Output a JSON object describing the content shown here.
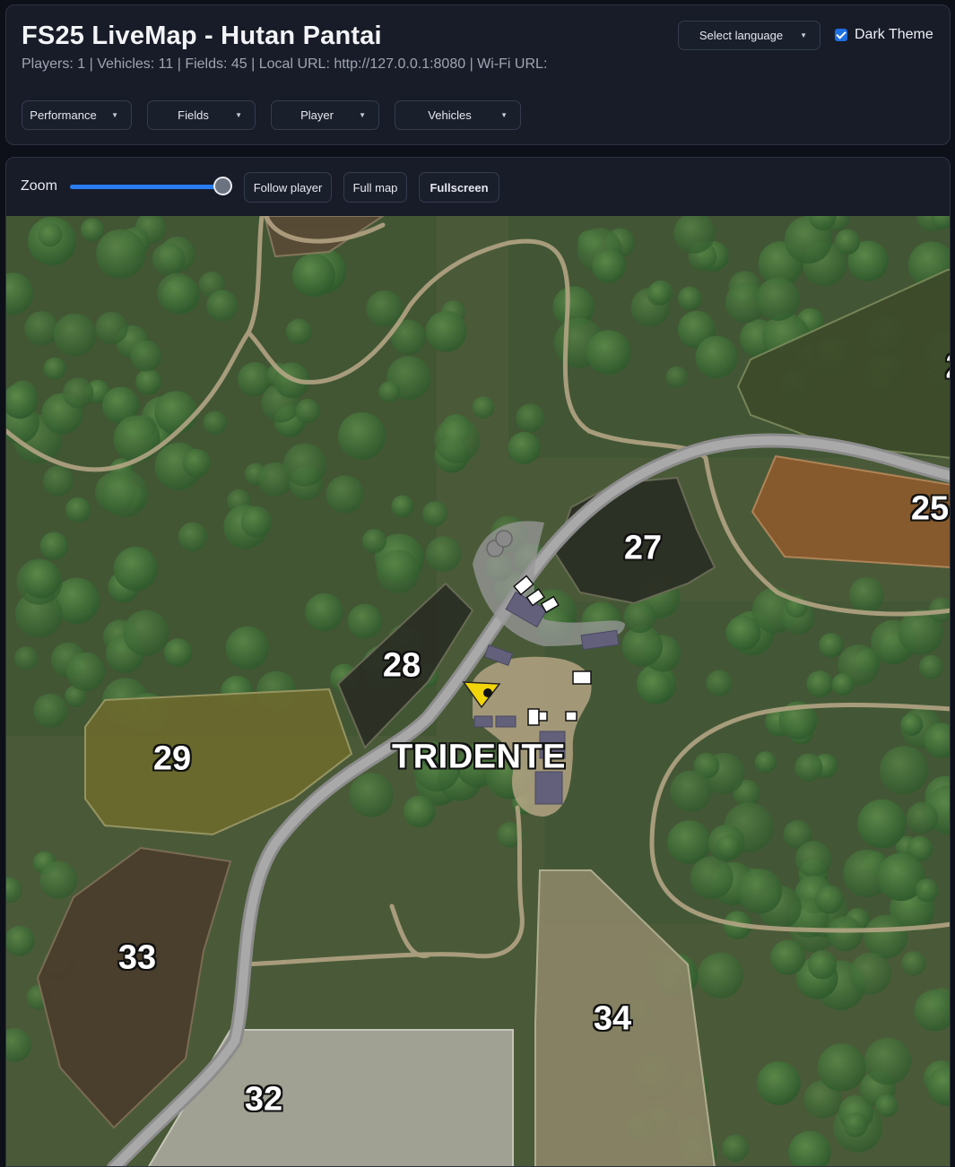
{
  "header": {
    "title": "FS25 LiveMap - Hutan Pantai",
    "status": "Players: 1 | Vehicles: 11 | Fields: 45 | Local URL: http://127.0.0.1:8080 | Wi-Fi URL:",
    "language_select": "Select language",
    "dark_theme": {
      "label": "Dark Theme",
      "checked": true
    },
    "dropdowns": [
      {
        "label": "Performance"
      },
      {
        "label": "Fields"
      },
      {
        "label": "Player"
      },
      {
        "label": "Vehicles"
      }
    ]
  },
  "toolbar": {
    "zoom_label": "Zoom",
    "zoom_level": 1.0,
    "follow_player": "Follow player",
    "full_map": "Full map",
    "fullscreen": "Fullscreen"
  },
  "map": {
    "place_name": "TRIDENTE",
    "fields": [
      {
        "number": "27",
        "color": "#2b2f24"
      },
      {
        "number": "28",
        "color": "#2b2f24"
      },
      {
        "number": "29",
        "color": "#6b6a2e"
      },
      {
        "number": "25",
        "color": "#8a5a2c"
      },
      {
        "number": "33",
        "color": "#4a3d2c"
      },
      {
        "number": "34",
        "color": "#8a8566"
      },
      {
        "number": "32",
        "color": "#a8a89a"
      },
      {
        "number": "2",
        "color": "#3d4a2a"
      }
    ],
    "player_marker_color": "#f2d40a",
    "terrain_color": "#4a5a38"
  }
}
